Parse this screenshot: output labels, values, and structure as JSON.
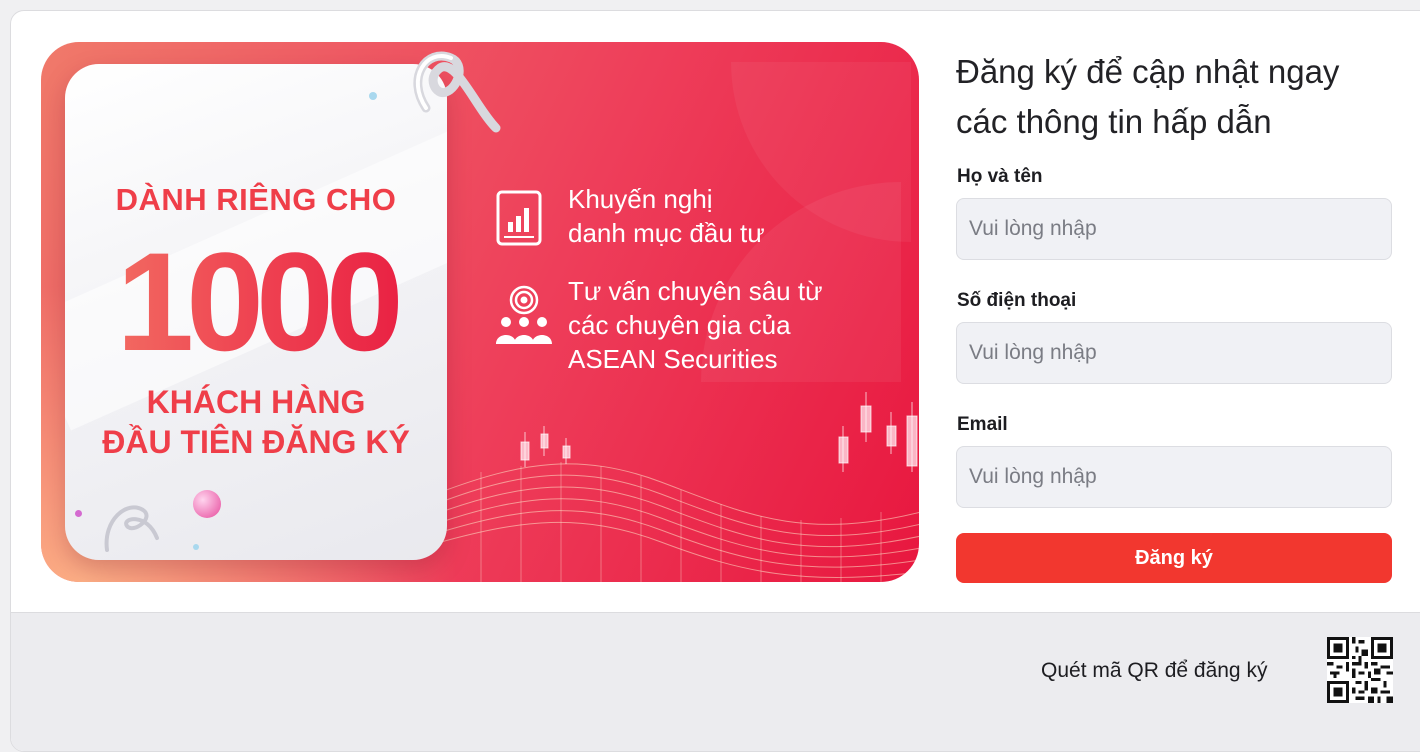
{
  "banner": {
    "top_line": "DÀNH RIÊNG CHO",
    "big_number": "1000",
    "bottom_line_1": "KHÁCH HÀNG",
    "bottom_line_2": "ĐẦU TIÊN ĐĂNG KÝ",
    "features": [
      {
        "icon": "report-chart-icon",
        "line1": "Khuyến nghị",
        "line2": "danh mục đầu tư",
        "line3": ""
      },
      {
        "icon": "expert-target-icon",
        "line1": "Tư vấn chuyên sâu từ",
        "line2": "các chuyên gia của",
        "line3": "ASEAN Securities"
      }
    ]
  },
  "form": {
    "title_line1": "Đăng ký để cập nhật ngay",
    "title_line2": "các thông tin hấp dẫn",
    "fields": [
      {
        "label": "Họ và tên",
        "placeholder": "Vui lòng nhập",
        "value": ""
      },
      {
        "label": "Số điện thoại",
        "placeholder": "Vui lòng nhập",
        "value": ""
      },
      {
        "label": "Email",
        "placeholder": "Vui lòng nhập",
        "value": ""
      }
    ],
    "submit_label": "Đăng ký"
  },
  "footer": {
    "qr_text": "Quét mã QR để đăng ký",
    "qr_icon": "qr-code-icon"
  },
  "colors": {
    "accent": "#f2372f",
    "banner_red": "#e8173f",
    "banner_text": "#ef3e49"
  }
}
